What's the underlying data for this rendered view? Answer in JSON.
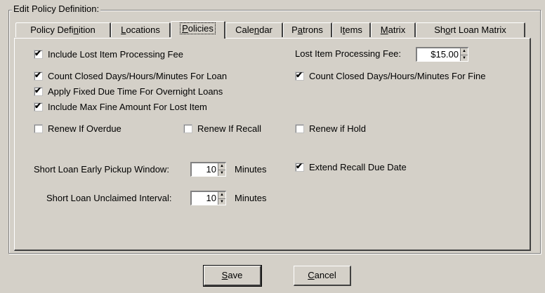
{
  "groupbox": {
    "title": "Edit  Policy Definition:"
  },
  "tabs": [
    {
      "pre": "Policy Defi",
      "key": "n",
      "post": "ition"
    },
    {
      "pre": "",
      "key": "L",
      "post": "ocations"
    },
    {
      "pre": "",
      "key": "P",
      "post": "olicies"
    },
    {
      "pre": "Cale",
      "key": "n",
      "post": "dar"
    },
    {
      "pre": "P",
      "key": "a",
      "post": "trons"
    },
    {
      "pre": "I",
      "key": "t",
      "post": "ems"
    },
    {
      "pre": "",
      "key": "M",
      "post": "atrix"
    },
    {
      "pre": "Sh",
      "key": "o",
      "post": "rt Loan Matrix"
    }
  ],
  "active_tab": "Policies",
  "policies": {
    "include_lost_fee": {
      "label": "Include Lost Item Processing Fee",
      "checked": true
    },
    "count_closed_loan": {
      "label": "Count Closed Days/Hours/Minutes For Loan",
      "checked": true
    },
    "apply_fixed_due": {
      "label": "Apply Fixed Due Time For Overnight Loans",
      "checked": true
    },
    "include_max_fine": {
      "label": "Include Max Fine Amount For Lost Item",
      "checked": true
    },
    "renew_overdue": {
      "label": "Renew If  Overdue",
      "checked": false
    },
    "renew_recall": {
      "label": "Renew If Recall",
      "checked": false
    },
    "renew_hold": {
      "label": "Renew if Hold",
      "checked": false
    },
    "count_closed_fine": {
      "label": "Count Closed Days/Hours/Minutes For Fine",
      "checked": true
    },
    "extend_recall": {
      "label": "Extend Recall Due Date",
      "checked": true
    },
    "lost_fee_label": "Lost Item Processing Fee:",
    "lost_fee_value": "$15.00",
    "early_pickup_label": "Short Loan Early Pickup Window:",
    "early_pickup_value": "10",
    "early_pickup_unit": "Minutes",
    "unclaimed_label": "Short Loan Unclaimed Interval:",
    "unclaimed_value": "10",
    "unclaimed_unit": "Minutes"
  },
  "check_mark": "✔",
  "buttons": {
    "save": {
      "key": "S",
      "rest": "ave"
    },
    "cancel": {
      "key": "C",
      "rest": "ancel"
    }
  }
}
